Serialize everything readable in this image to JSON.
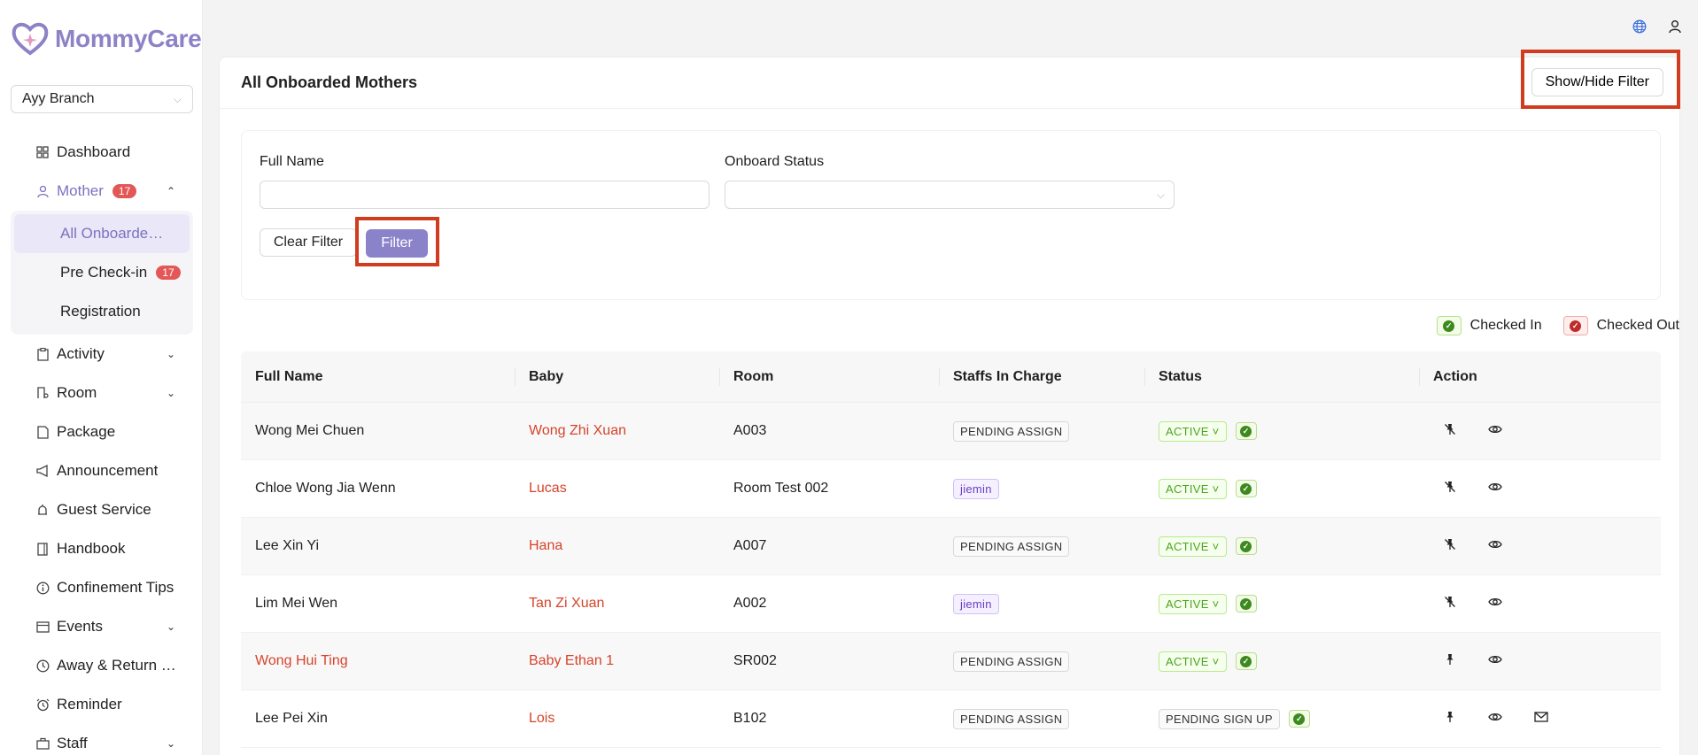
{
  "app": {
    "name": "MommyCare",
    "plus": "+"
  },
  "branch": {
    "selected": "Ayy Branch"
  },
  "sidebar": {
    "items": [
      {
        "label": "Dashboard",
        "icon": "dashboard-icon"
      },
      {
        "label": "Mother",
        "icon": "user-icon",
        "badge": "17"
      },
      {
        "label": "Activity",
        "icon": "clipboard-icon"
      },
      {
        "label": "Room",
        "icon": "room-icon"
      },
      {
        "label": "Package",
        "icon": "package-icon"
      },
      {
        "label": "Announcement",
        "icon": "megaphone-icon"
      },
      {
        "label": "Guest Service",
        "icon": "bell-icon"
      },
      {
        "label": "Handbook",
        "icon": "book-icon"
      },
      {
        "label": "Confinement Tips",
        "icon": "info-icon"
      },
      {
        "label": "Events",
        "icon": "calendar-icon"
      },
      {
        "label": "Away & Return L...",
        "icon": "clock-icon"
      },
      {
        "label": "Reminder",
        "icon": "alarm-icon"
      },
      {
        "label": "Staff",
        "icon": "staff-icon"
      }
    ],
    "mother_sub": [
      {
        "label": "All Onboarded ..."
      },
      {
        "label": "Pre Check-in",
        "badge": "17"
      },
      {
        "label": "Registration"
      }
    ]
  },
  "page": {
    "title": "All Onboarded Mothers",
    "toggle_filter": "Show/Hide Filter"
  },
  "filter": {
    "full_name_label": "Full Name",
    "full_name_value": "",
    "status_label": "Onboard Status",
    "status_value": "",
    "clear_label": "Clear Filter",
    "submit_label": "Filter"
  },
  "legend": {
    "checked_in": "Checked In",
    "checked_out": "Checked Out"
  },
  "table": {
    "columns": [
      "Full Name",
      "Baby",
      "Room",
      "Staffs In Charge",
      "Status",
      "Action"
    ],
    "rows": [
      {
        "name": "Wong Mei Chuen",
        "name_red": false,
        "baby": "Wong Zhi Xuan",
        "room": "A003",
        "staff": "PENDING ASSIGN",
        "staff_type": "default",
        "status": "ACTIVE",
        "status_type": "green",
        "pinned": false,
        "mail": false
      },
      {
        "name": "Chloe Wong Jia Wenn",
        "name_red": false,
        "baby": "Lucas",
        "room": "Room Test 002",
        "staff": "jiemin",
        "staff_type": "purple",
        "status": "ACTIVE",
        "status_type": "green",
        "pinned": false,
        "mail": false
      },
      {
        "name": "Lee Xin Yi",
        "name_red": false,
        "baby": "Hana",
        "room": "A007",
        "staff": "PENDING ASSIGN",
        "staff_type": "default",
        "status": "ACTIVE",
        "status_type": "green",
        "pinned": false,
        "mail": false
      },
      {
        "name": "Lim Mei Wen",
        "name_red": false,
        "baby": "Tan Zi Xuan",
        "room": "A002",
        "staff": "jiemin",
        "staff_type": "purple",
        "status": "ACTIVE",
        "status_type": "green",
        "pinned": false,
        "mail": false
      },
      {
        "name": "Wong Hui Ting",
        "name_red": true,
        "baby": "Baby Ethan 1",
        "room": "SR002",
        "staff": "PENDING ASSIGN",
        "staff_type": "default",
        "status": "ACTIVE",
        "status_type": "green",
        "pinned": true,
        "mail": false
      },
      {
        "name": "Lee Pei Xin",
        "name_red": false,
        "baby": "Lois",
        "room": "B102",
        "staff": "PENDING ASSIGN",
        "staff_type": "default",
        "status": "PENDING SIGN UP",
        "status_type": "default",
        "pinned": true,
        "mail": true
      }
    ]
  },
  "colors": {
    "brand": "#8c82c6",
    "primary_button": "#8a83c9",
    "highlight_box": "#d13b1f",
    "baby_name": "#d5442a"
  }
}
